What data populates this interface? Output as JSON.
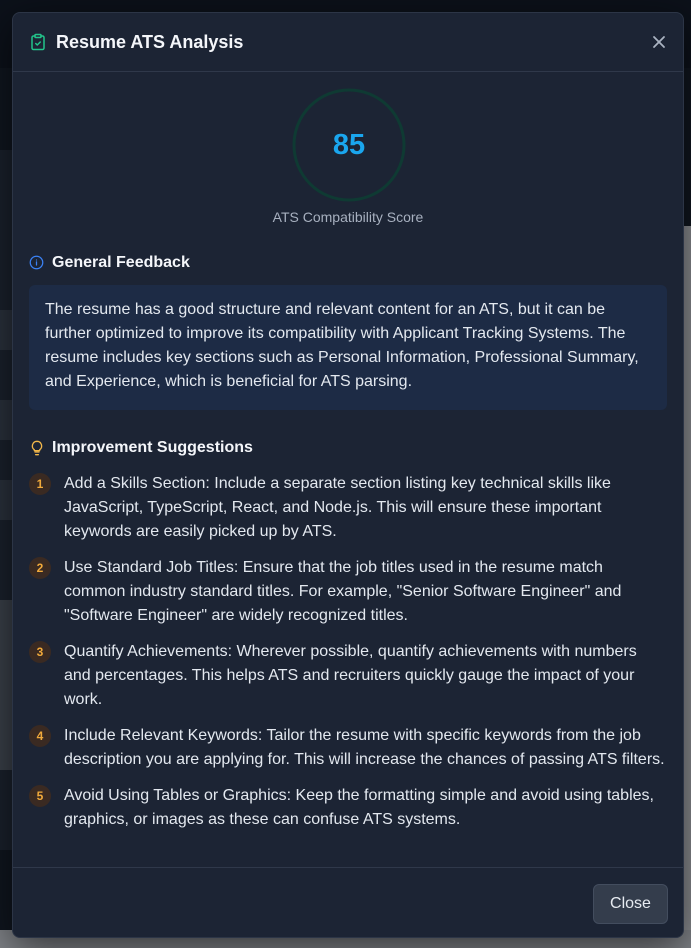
{
  "modal": {
    "title": "Resume ATS Analysis",
    "header_icon": "clipboard-check-icon",
    "close_icon": "close-icon"
  },
  "score": {
    "value": "85",
    "label": "ATS Compatibility Score",
    "ring_color": "#0f3a33"
  },
  "general_feedback": {
    "icon": "info-icon",
    "title": "General Feedback",
    "text": "The resume has a good structure and relevant content for an ATS, but it can be further optimized to improve its compatibility with Applicant Tracking Systems. The resume includes key sections such as Personal Information, Professional Summary, and Experience, which is beneficial for ATS parsing."
  },
  "suggestions": {
    "icon": "lightbulb-icon",
    "title": "Improvement Suggestions",
    "items": [
      {
        "num": "1",
        "text": "Add a Skills Section: Include a separate section listing key technical skills like JavaScript, TypeScript, React, and Node.js. This will ensure these important keywords are easily picked up by ATS."
      },
      {
        "num": "2",
        "text": "Use Standard Job Titles: Ensure that the job titles used in the resume match common industry standard titles. For example, \"Senior Software Engineer\" and \"Software Engineer\" are widely recognized titles."
      },
      {
        "num": "3",
        "text": "Quantify Achievements: Wherever possible, quantify achievements with numbers and percentages. This helps ATS and recruiters quickly gauge the impact of your work."
      },
      {
        "num": "4",
        "text": "Include Relevant Keywords: Tailor the resume with specific keywords from the job description you are applying for. This will increase the chances of passing ATS filters."
      },
      {
        "num": "5",
        "text": "Avoid Using Tables or Graphics: Keep the formatting simple and avoid using tables, graphics, or images as these can confuse ATS systems."
      }
    ]
  },
  "footer": {
    "close_label": "Close"
  },
  "colors": {
    "accent_score": "#1aa6ee",
    "number_badge": "#f0a93b",
    "icon_green": "#22c58b",
    "icon_blue": "#3b82f6",
    "icon_yellow": "#f2b84b"
  }
}
